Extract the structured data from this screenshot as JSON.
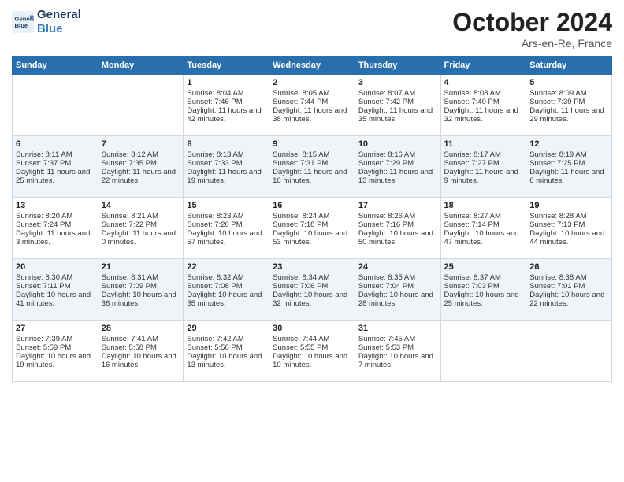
{
  "header": {
    "logo_line1": "General",
    "logo_line2": "Blue",
    "month_year": "October 2024",
    "location": "Ars-en-Re, France"
  },
  "weekdays": [
    "Sunday",
    "Monday",
    "Tuesday",
    "Wednesday",
    "Thursday",
    "Friday",
    "Saturday"
  ],
  "weeks": [
    [
      {
        "day": "",
        "content": ""
      },
      {
        "day": "",
        "content": ""
      },
      {
        "day": "1",
        "content": "Sunrise: 8:04 AM\nSunset: 7:46 PM\nDaylight: 11 hours and 42 minutes."
      },
      {
        "day": "2",
        "content": "Sunrise: 8:05 AM\nSunset: 7:44 PM\nDaylight: 11 hours and 38 minutes."
      },
      {
        "day": "3",
        "content": "Sunrise: 8:07 AM\nSunset: 7:42 PM\nDaylight: 11 hours and 35 minutes."
      },
      {
        "day": "4",
        "content": "Sunrise: 8:08 AM\nSunset: 7:40 PM\nDaylight: 11 hours and 32 minutes."
      },
      {
        "day": "5",
        "content": "Sunrise: 8:09 AM\nSunset: 7:39 PM\nDaylight: 11 hours and 29 minutes."
      }
    ],
    [
      {
        "day": "6",
        "content": "Sunrise: 8:11 AM\nSunset: 7:37 PM\nDaylight: 11 hours and 25 minutes."
      },
      {
        "day": "7",
        "content": "Sunrise: 8:12 AM\nSunset: 7:35 PM\nDaylight: 11 hours and 22 minutes."
      },
      {
        "day": "8",
        "content": "Sunrise: 8:13 AM\nSunset: 7:33 PM\nDaylight: 11 hours and 19 minutes."
      },
      {
        "day": "9",
        "content": "Sunrise: 8:15 AM\nSunset: 7:31 PM\nDaylight: 11 hours and 16 minutes."
      },
      {
        "day": "10",
        "content": "Sunrise: 8:16 AM\nSunset: 7:29 PM\nDaylight: 11 hours and 13 minutes."
      },
      {
        "day": "11",
        "content": "Sunrise: 8:17 AM\nSunset: 7:27 PM\nDaylight: 11 hours and 9 minutes."
      },
      {
        "day": "12",
        "content": "Sunrise: 8:19 AM\nSunset: 7:25 PM\nDaylight: 11 hours and 6 minutes."
      }
    ],
    [
      {
        "day": "13",
        "content": "Sunrise: 8:20 AM\nSunset: 7:24 PM\nDaylight: 11 hours and 3 minutes."
      },
      {
        "day": "14",
        "content": "Sunrise: 8:21 AM\nSunset: 7:22 PM\nDaylight: 11 hours and 0 minutes."
      },
      {
        "day": "15",
        "content": "Sunrise: 8:23 AM\nSunset: 7:20 PM\nDaylight: 10 hours and 57 minutes."
      },
      {
        "day": "16",
        "content": "Sunrise: 8:24 AM\nSunset: 7:18 PM\nDaylight: 10 hours and 53 minutes."
      },
      {
        "day": "17",
        "content": "Sunrise: 8:26 AM\nSunset: 7:16 PM\nDaylight: 10 hours and 50 minutes."
      },
      {
        "day": "18",
        "content": "Sunrise: 8:27 AM\nSunset: 7:14 PM\nDaylight: 10 hours and 47 minutes."
      },
      {
        "day": "19",
        "content": "Sunrise: 8:28 AM\nSunset: 7:13 PM\nDaylight: 10 hours and 44 minutes."
      }
    ],
    [
      {
        "day": "20",
        "content": "Sunrise: 8:30 AM\nSunset: 7:11 PM\nDaylight: 10 hours and 41 minutes."
      },
      {
        "day": "21",
        "content": "Sunrise: 8:31 AM\nSunset: 7:09 PM\nDaylight: 10 hours and 38 minutes."
      },
      {
        "day": "22",
        "content": "Sunrise: 8:32 AM\nSunset: 7:08 PM\nDaylight: 10 hours and 35 minutes."
      },
      {
        "day": "23",
        "content": "Sunrise: 8:34 AM\nSunset: 7:06 PM\nDaylight: 10 hours and 32 minutes."
      },
      {
        "day": "24",
        "content": "Sunrise: 8:35 AM\nSunset: 7:04 PM\nDaylight: 10 hours and 28 minutes."
      },
      {
        "day": "25",
        "content": "Sunrise: 8:37 AM\nSunset: 7:03 PM\nDaylight: 10 hours and 25 minutes."
      },
      {
        "day": "26",
        "content": "Sunrise: 8:38 AM\nSunset: 7:01 PM\nDaylight: 10 hours and 22 minutes."
      }
    ],
    [
      {
        "day": "27",
        "content": "Sunrise: 7:39 AM\nSunset: 5:59 PM\nDaylight: 10 hours and 19 minutes."
      },
      {
        "day": "28",
        "content": "Sunrise: 7:41 AM\nSunset: 5:58 PM\nDaylight: 10 hours and 16 minutes."
      },
      {
        "day": "29",
        "content": "Sunrise: 7:42 AM\nSunset: 5:56 PM\nDaylight: 10 hours and 13 minutes."
      },
      {
        "day": "30",
        "content": "Sunrise: 7:44 AM\nSunset: 5:55 PM\nDaylight: 10 hours and 10 minutes."
      },
      {
        "day": "31",
        "content": "Sunrise: 7:45 AM\nSunset: 5:53 PM\nDaylight: 10 hours and 7 minutes."
      },
      {
        "day": "",
        "content": ""
      },
      {
        "day": "",
        "content": ""
      }
    ]
  ]
}
